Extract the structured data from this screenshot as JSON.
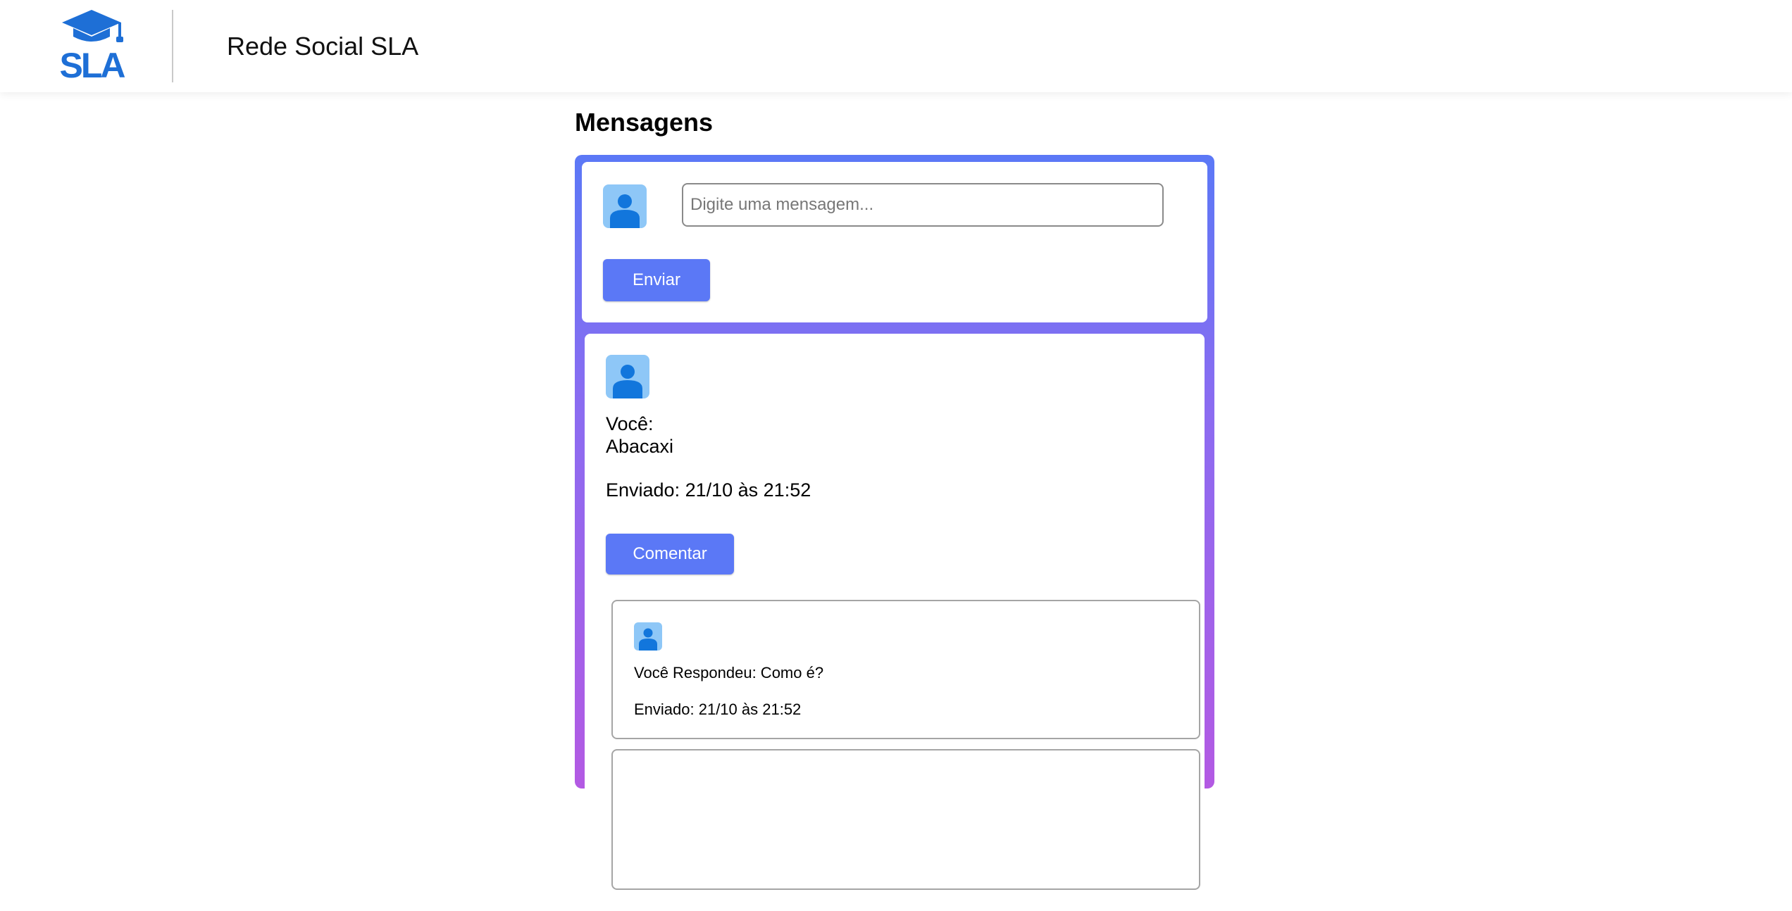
{
  "header": {
    "logo_text": "SLA",
    "app_title": "Rede Social SLA"
  },
  "page": {
    "title": "Mensagens"
  },
  "compose": {
    "placeholder": "Digite uma mensagem...",
    "send_label": "Enviar"
  },
  "messages": [
    {
      "author": "Você:",
      "text": "Abacaxi",
      "sent": "Enviado: 21/10 às 21:52",
      "comment_label": "Comentar",
      "replies": [
        {
          "text": "Você Respondeu: Como é?",
          "sent": "Enviado: 21/10 às 21:52"
        }
      ]
    }
  ],
  "colors": {
    "accent": "#5b78f6",
    "gradient_start": "#5b78f6",
    "gradient_end": "#b35ae3",
    "avatar_bg": "#8ec7f7",
    "avatar_icon": "#1276dc",
    "logo": "#1e6fd6"
  },
  "icons": {
    "logo": "graduation-cap-logo",
    "avatar": "user-icon"
  }
}
